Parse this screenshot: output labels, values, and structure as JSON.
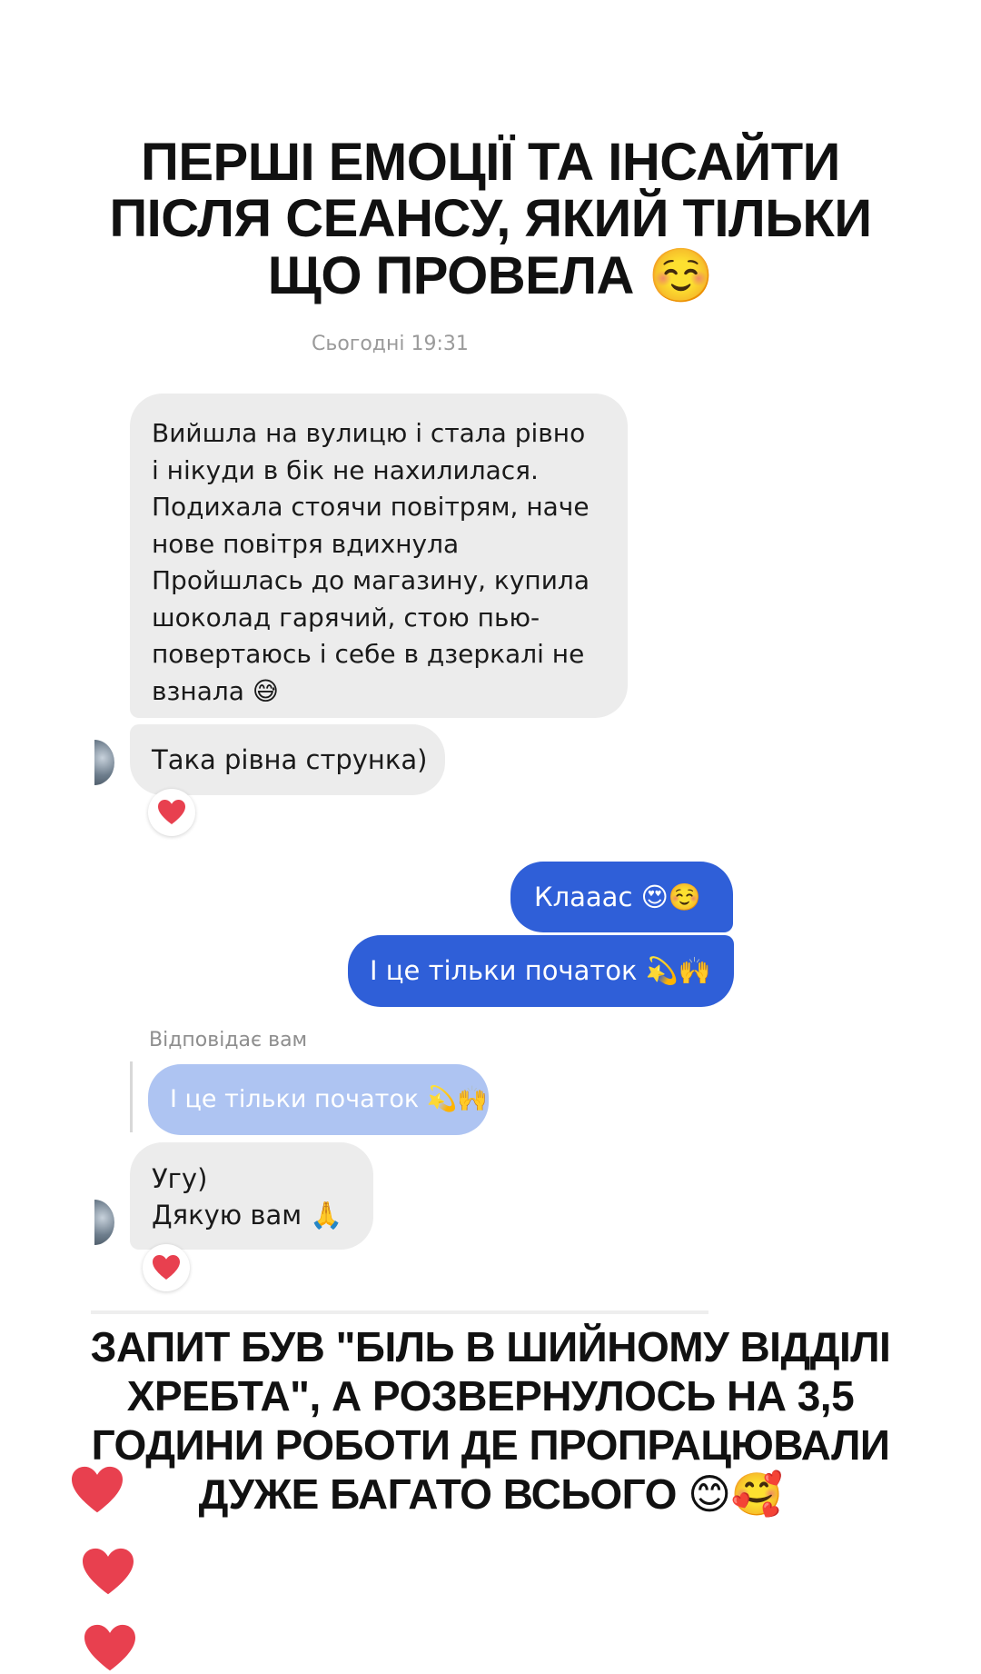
{
  "top_headline": {
    "line1": "ПЕРШІ ЕМОЦІЇ ТА ІНСАЙТИ",
    "line2": "ПІСЛЯ СЕАНСУ, ЯКИЙ ТІЛЬКИ",
    "line3": "ЩО ПРОВЕЛА",
    "emoji": "☺️"
  },
  "chat": {
    "timestamp": "Сьогодні 19:31",
    "messages": [
      {
        "direction": "incoming",
        "lines": [
          "Вийшла на вулицю і стала рівно",
          "і нікуди в бік не нахилилася.",
          "Подихала стоячи повітрям, наче",
          "нове повітря вдихнула",
          "Пройшлась до магазину, купила",
          "шоколад гарячий, стою пью-",
          "повертаюсь і себе в дзеркалі не",
          "взнала 😅"
        ]
      },
      {
        "direction": "incoming",
        "text": "Така рівна струнка)",
        "reaction": "❤️"
      },
      {
        "direction": "outgoing",
        "text": "Клааас 😍☺️"
      },
      {
        "direction": "outgoing",
        "text": "І це тільки початок 💫🙌"
      },
      {
        "direction": "incoming",
        "reply_label": "Відповідає вам",
        "quoted_text": "І це тільки початок 💫🙌",
        "lines": [
          "Угу)",
          "Дякую вам 🙏"
        ],
        "reaction": "❤️"
      }
    ]
  },
  "bottom_headline": {
    "line1": "ЗАПИТ БУВ \"БІЛЬ В ШИЙНОМУ ВІДДІЛІ",
    "line2": "ХРЕБТА\", А РОЗВЕРНУЛОСЬ НА 3,5",
    "line3": "ГОДИНИ РОБОТИ ДЕ ПРОПРАЦЮВАЛИ",
    "line4": "ДУЖЕ БАГАТО ВСЬОГО 😊🥰"
  },
  "colors": {
    "incoming_bubble": "#ececec",
    "outgoing_bubble": "#2f5fd8",
    "quoted_bubble": "#aec4f2",
    "heart": "#e8404f"
  },
  "icons": [
    "heart-icon",
    "avatar"
  ]
}
